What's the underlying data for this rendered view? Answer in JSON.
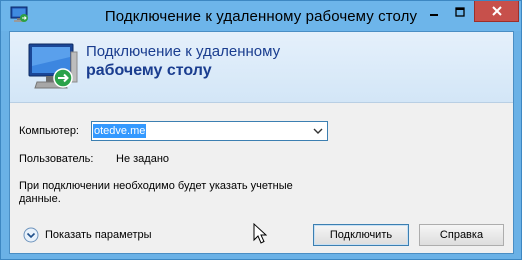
{
  "window": {
    "title": "Подключение к удаленному рабочему столу",
    "colors": {
      "titlebar": "#6db5ea",
      "close": "#c7504b",
      "banner_text": "#1a3d8f"
    }
  },
  "banner": {
    "line1": "Подключение к удаленному",
    "line2": "рабочему столу",
    "icon": "remote-desktop-monitor-icon"
  },
  "form": {
    "computer_label": "Компьютер:",
    "computer_value": "otedve.me",
    "user_label": "Пользователь:",
    "user_value": "Не задано",
    "info_line1": "При подключении необходимо будет указать учетные",
    "info_line2": "данные."
  },
  "footer": {
    "options_label": "Показать параметры",
    "connect_label": "Подключить",
    "help_label": "Справка"
  }
}
